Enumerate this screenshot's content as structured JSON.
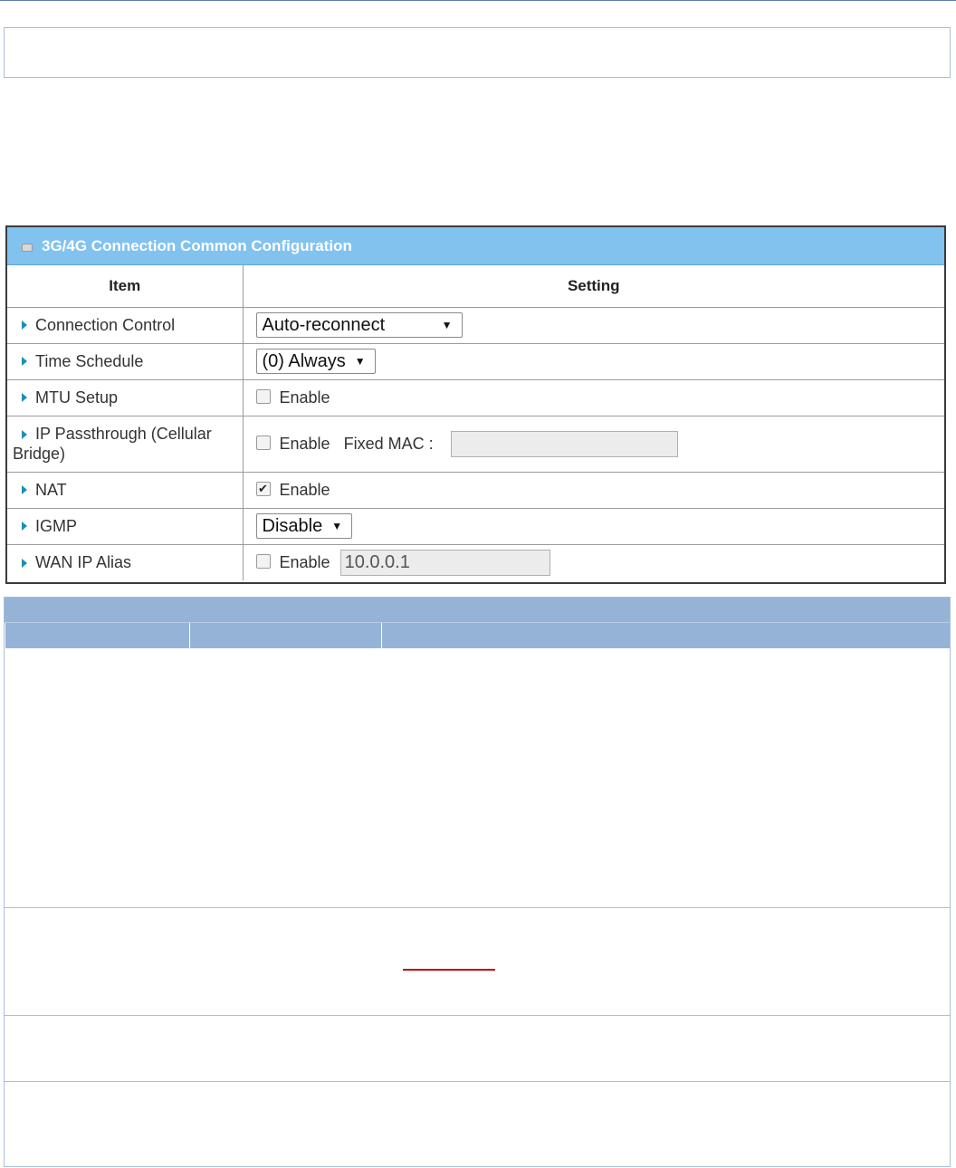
{
  "panel": {
    "title": "3G/4G Connection Common Configuration",
    "col_item": "Item",
    "col_setting": "Setting"
  },
  "rows": {
    "connection_control": {
      "label": "Connection Control",
      "value": "Auto-reconnect"
    },
    "time_schedule": {
      "label": "Time Schedule",
      "value": "(0) Always"
    },
    "mtu_setup": {
      "label": "MTU Setup",
      "enable_label": "Enable",
      "checked": false
    },
    "ip_passthrough": {
      "label": "IP Passthrough (Cellular Bridge)",
      "enable_label": "Enable",
      "checked": false,
      "fixed_mac_label": "Fixed MAC :",
      "fixed_mac_value": ""
    },
    "nat": {
      "label": "NAT",
      "enable_label": "Enable",
      "checked": true
    },
    "igmp": {
      "label": "IGMP",
      "value": "Disable"
    },
    "wan_ip_alias": {
      "label": "WAN IP Alias",
      "enable_label": "Enable",
      "checked": false,
      "ip_value": "10.0.0.1"
    }
  },
  "colors": {
    "header_blue": "#82c2ef",
    "desc_head": "#95b3d7",
    "arrow": "#1b8fb0",
    "link_red": "#c00000"
  },
  "icons": {
    "panel": "window-icon",
    "row_marker": "triangle-right-icon",
    "dropdown": "caret-down-icon",
    "check": "checkmark-icon"
  }
}
